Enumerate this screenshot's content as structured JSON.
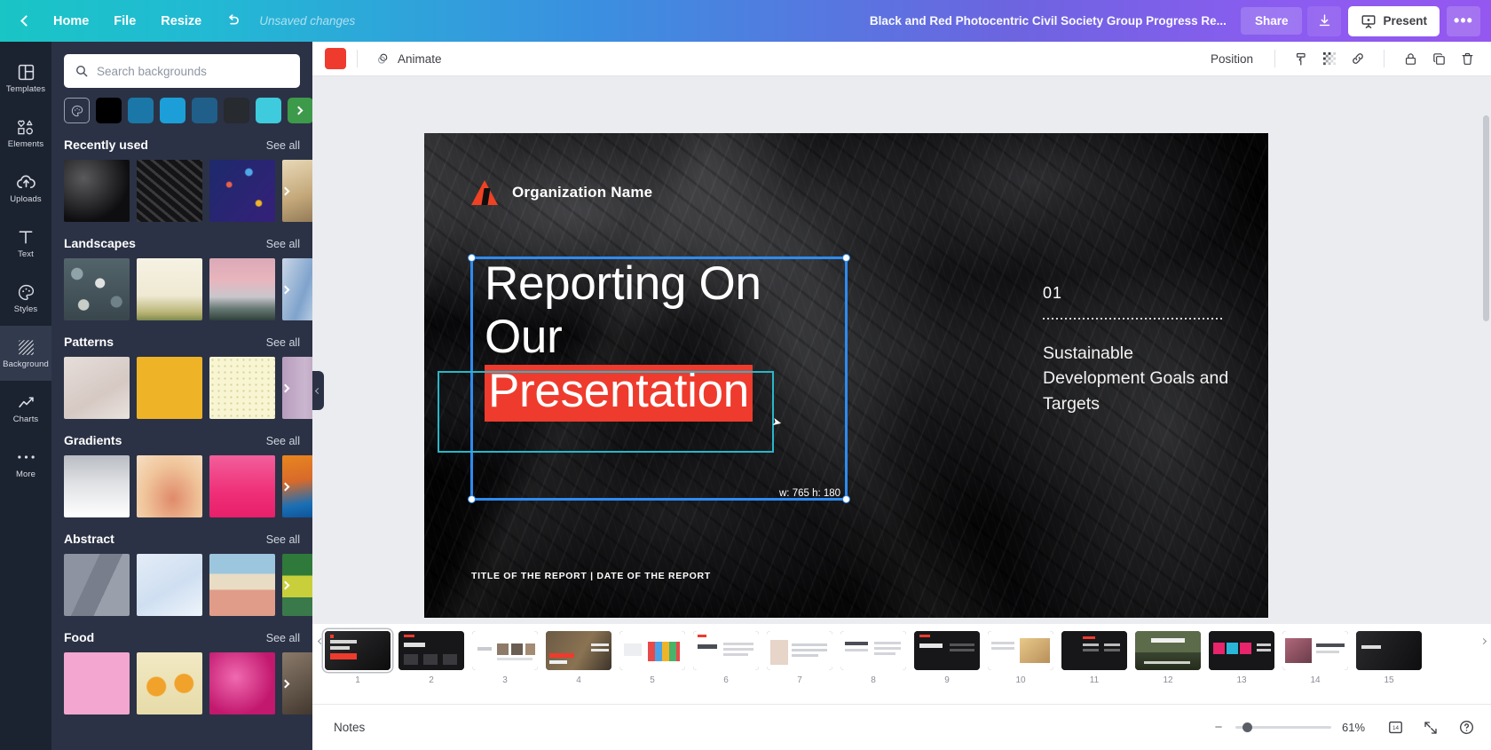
{
  "topbar": {
    "back_icon": "chevron-left-icon",
    "home_label": "Home",
    "file_label": "File",
    "resize_label": "Resize",
    "undo_icon": "undo-arrow-icon",
    "status": "Unsaved changes",
    "doc_title": "Black and Red Photocentric Civil Society Group Progress Re...",
    "share_label": "Share",
    "download_icon": "download-icon",
    "present_label": "Present",
    "present_icon": "presentation-screen-icon",
    "more_label": "•••",
    "accent_start": "#19c5c5",
    "accent_end": "#9457ef"
  },
  "rail": {
    "items": [
      {
        "label": "Templates",
        "icon": "templates-grid-icon",
        "active": false
      },
      {
        "label": "Elements",
        "icon": "elements-shapes-icon",
        "active": false
      },
      {
        "label": "Uploads",
        "icon": "upload-cloud-icon",
        "active": false
      },
      {
        "label": "Text",
        "icon": "text-t-icon",
        "active": false
      },
      {
        "label": "Styles",
        "icon": "styles-palette-icon",
        "active": false
      },
      {
        "label": "Background",
        "icon": "background-hatch-icon",
        "active": true
      },
      {
        "label": "Charts",
        "icon": "chart-line-icon",
        "active": false
      },
      {
        "label": "More",
        "icon": "more-dots-icon",
        "active": false
      }
    ]
  },
  "panel": {
    "search_placeholder": "Search backgrounds",
    "search_value": "",
    "search_icon": "search-icon",
    "color_picker_icon": "color-palette-icon",
    "swatches": [
      "#000000",
      "#1a77a8",
      "#1c9fd8",
      "#1f5f8a",
      "#272a2e",
      "#3ecbdd",
      "#3d9a4a"
    ],
    "sections": [
      {
        "title": "Recently used",
        "see_all": "See all",
        "thumbs": [
          "dark-marble-1",
          "dark-marble-2",
          "blue-confetti",
          "beige-blur"
        ]
      },
      {
        "title": "Landscapes",
        "see_all": "See all",
        "thumbs": [
          "pebbles",
          "cream-field",
          "pink-mountains",
          "blue-gradient-sky"
        ]
      },
      {
        "title": "Patterns",
        "see_all": "See all",
        "thumbs": [
          "beige-texture",
          "yellow-solid",
          "cream-dots",
          "mauve-stripe"
        ]
      },
      {
        "title": "Gradients",
        "see_all": "See all",
        "thumbs": [
          "white-grey",
          "peach-blur",
          "pink-magenta",
          "orange-blue"
        ]
      },
      {
        "title": "Abstract",
        "see_all": "See all",
        "thumbs": [
          "grey-facets",
          "blue-lowpoly",
          "desert-sky",
          "green-yellow"
        ]
      },
      {
        "title": "Food",
        "see_all": "See all",
        "thumbs": [
          "pink-solid",
          "oranges",
          "magenta-blur",
          "dark-food"
        ]
      }
    ]
  },
  "editor_toolbar": {
    "color_chip": "#ee3b2d",
    "animate_label": "Animate",
    "animate_icon": "animate-swirl-icon",
    "position_label": "Position",
    "icons": [
      "paint-roller-icon",
      "transparency-icon",
      "link-icon",
      "lock-icon",
      "duplicate-icon",
      "trash-icon"
    ]
  },
  "slide": {
    "org_name": "Organization Name",
    "logo_icon": "red-triangle-logo",
    "title_lines": [
      "Reporting On",
      "Our"
    ],
    "title_highlight": "Presentation",
    "highlight_color": "#ee3b2d",
    "section_number": "01",
    "section_text": "Sustainable Development Goals and Targets",
    "footer": "TITLE OF THE REPORT  |  DATE OF THE REPORT",
    "selection_dimensions": "w: 765 h: 180",
    "selection_color": "#2e8bf0",
    "inner_selection_color": "#29b6c9"
  },
  "slide_strip": {
    "selected_index": 1,
    "slides": [
      {
        "number": "1",
        "style": "dark-title"
      },
      {
        "number": "2",
        "style": "dark-rapid"
      },
      {
        "number": "3",
        "style": "light-authors"
      },
      {
        "number": "4",
        "style": "bear-photo"
      },
      {
        "number": "5",
        "style": "light-colorgrid"
      },
      {
        "number": "6",
        "style": "light-objective"
      },
      {
        "number": "7",
        "style": "light-portrait"
      },
      {
        "number": "8",
        "style": "light-text"
      },
      {
        "number": "9",
        "style": "dark-report"
      },
      {
        "number": "10",
        "style": "light-photo"
      },
      {
        "number": "11",
        "style": "dark-columns"
      },
      {
        "number": "12",
        "style": "landscape-photo"
      },
      {
        "number": "13",
        "style": "dark-swatches"
      },
      {
        "number": "14",
        "style": "light-split"
      },
      {
        "number": "15",
        "style": "dark-edge"
      }
    ]
  },
  "bottombar": {
    "notes_label": "Notes",
    "zoom_minus": "−",
    "zoom_value": "61%",
    "pages_icon": "page-count-icon",
    "fullscreen_icon": "expand-icon",
    "help_icon": "help-question-icon"
  }
}
